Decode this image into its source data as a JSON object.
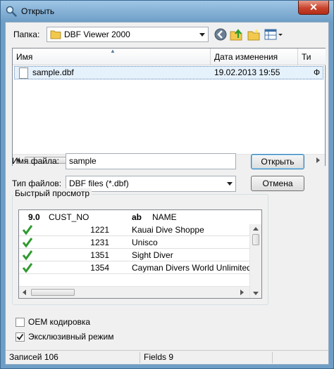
{
  "window": {
    "title": "Открыть",
    "close_label": "✕"
  },
  "folder": {
    "label": "Папка:",
    "value": "DBF Viewer 2000"
  },
  "file_list": {
    "columns": [
      "Имя",
      "Дата изменения",
      "Ти"
    ],
    "rows": [
      {
        "name": "sample.dbf",
        "modified": "19.02.2013 19:55",
        "type": "Ф"
      }
    ]
  },
  "file_name": {
    "label": "Имя файла:",
    "value": "sample"
  },
  "file_type": {
    "label": "Тип файлов:",
    "value": "DBF files (*.dbf)"
  },
  "buttons": {
    "open": "Открыть",
    "cancel": "Отмена"
  },
  "preview": {
    "title": "Быстрый просмотр",
    "col1_type": "9.0",
    "col1_name": "CUST_NO",
    "col2_type": "ab",
    "col2_name": "NAME",
    "rows": [
      {
        "cust_no": "1221",
        "name": "Kauai Dive Shoppe"
      },
      {
        "cust_no": "1231",
        "name": "Unisco"
      },
      {
        "cust_no": "1351",
        "name": "Sight Diver"
      },
      {
        "cust_no": "1354",
        "name": "Cayman Divers World Unlimited"
      }
    ]
  },
  "options": {
    "oem_label": "OEM кодировка",
    "oem_checked": false,
    "exclusive_label": "Эксклюзивный режим",
    "exclusive_checked": true
  },
  "status": {
    "records": "Записей 106",
    "fields": "Fields 9"
  }
}
